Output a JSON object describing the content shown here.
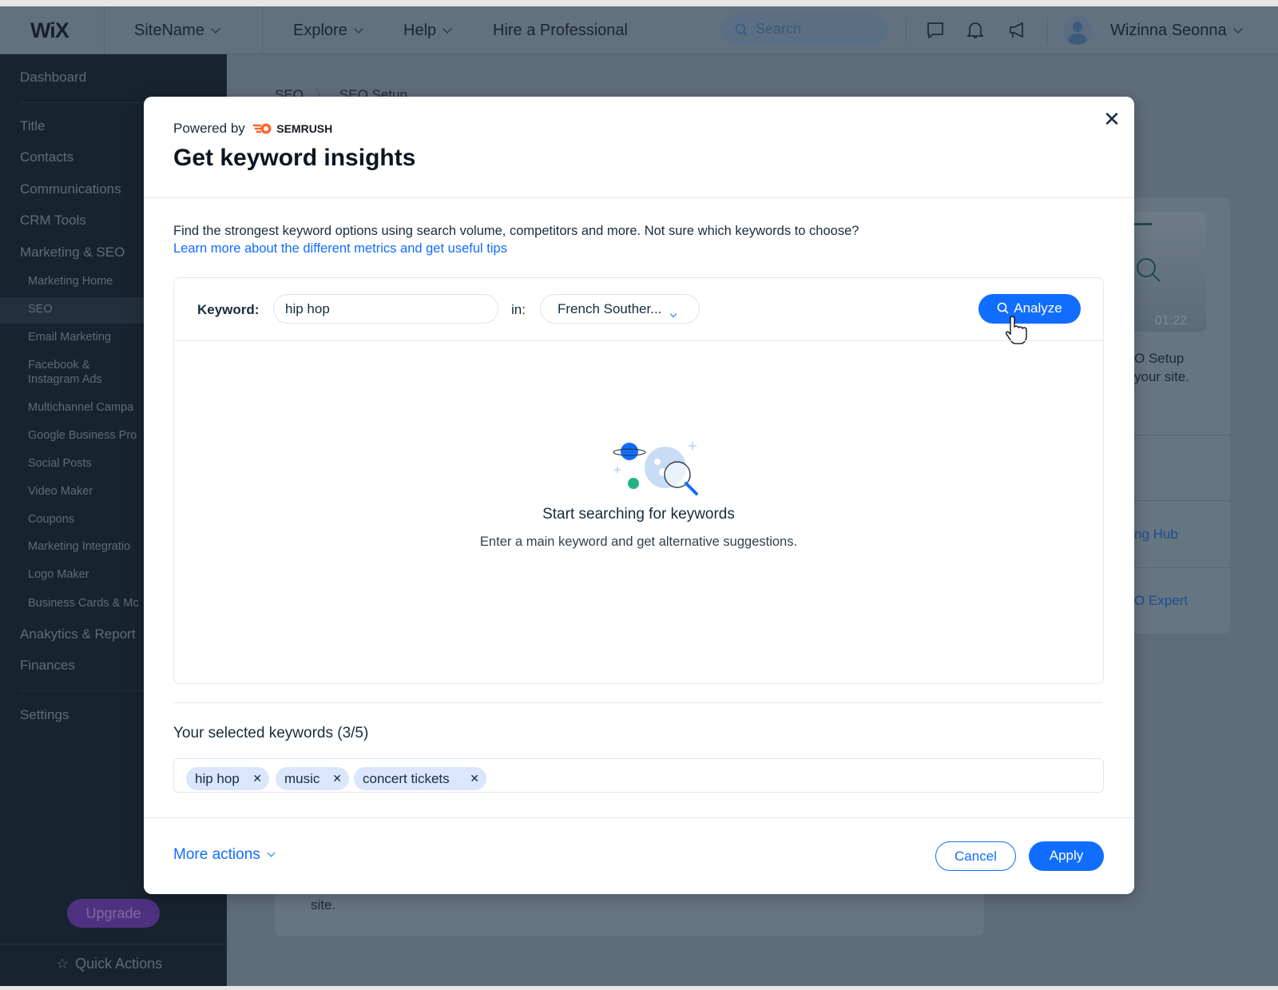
{
  "topbar": {
    "logo": "WiX",
    "site_name": "SiteName",
    "nav": [
      "Explore",
      "Help",
      "Hire a Professional"
    ],
    "search_placeholder": "Search",
    "user_name": "Wizinna Seonna"
  },
  "sidebar": {
    "items": [
      {
        "label": "Dashboard"
      },
      {
        "label": "Title"
      },
      {
        "label": "Contacts"
      },
      {
        "label": "Communications"
      },
      {
        "label": "CRM Tools"
      },
      {
        "label": "Marketing & SEO"
      },
      {
        "label": "Marketing Home"
      },
      {
        "label": "SEO",
        "selected": true
      },
      {
        "label": "Email Marketing"
      },
      {
        "label": "Facebook &"
      },
      {
        "label": "Instagram Ads"
      },
      {
        "label": "Multichannel Campa"
      },
      {
        "label": "Google Business Pro"
      },
      {
        "label": "Social Posts"
      },
      {
        "label": "Video Maker"
      },
      {
        "label": "Coupons"
      },
      {
        "label": "Marketing Integratio"
      },
      {
        "label": "Logo Maker"
      },
      {
        "label": "Business Cards & Mc"
      },
      {
        "label": "Anakytics & Report"
      },
      {
        "label": "Finances"
      },
      {
        "label": "Settings"
      }
    ],
    "upgrade": "Upgrade",
    "quick_actions": "Quick Actions"
  },
  "background": {
    "breadcrumb": [
      "SEO",
      "SEO Setup"
    ],
    "video_time": "01:22",
    "card_line1": "O Setup",
    "card_line2": "your site.",
    "link1": "ng Hub",
    "link2": "O Expert",
    "bottom_text": "site."
  },
  "modal": {
    "powered_by": "Powered by",
    "brand": "SEMRUSH",
    "brand_color": "#ff642d",
    "title": "Get keyword insights",
    "description": "Find the strongest keyword options using search volume, competitors and more. Not sure which keywords to choose?",
    "learn_more": "Learn more about the different metrics and get useful tips",
    "keyword_label": "Keyword:",
    "keyword_value": "hip hop",
    "in_label": "in:",
    "location": "French Souther...",
    "analyze": "Analyze",
    "empty_title": "Start searching for keywords",
    "empty_subtitle": "Enter a main keyword and get alternative suggestions.",
    "selected_title": "Your selected keywords (3/5)",
    "chips": [
      "hip hop",
      "music",
      "concert tickets"
    ],
    "more_actions": "More actions",
    "cancel": "Cancel",
    "apply": "Apply",
    "accent": "#116dff"
  }
}
